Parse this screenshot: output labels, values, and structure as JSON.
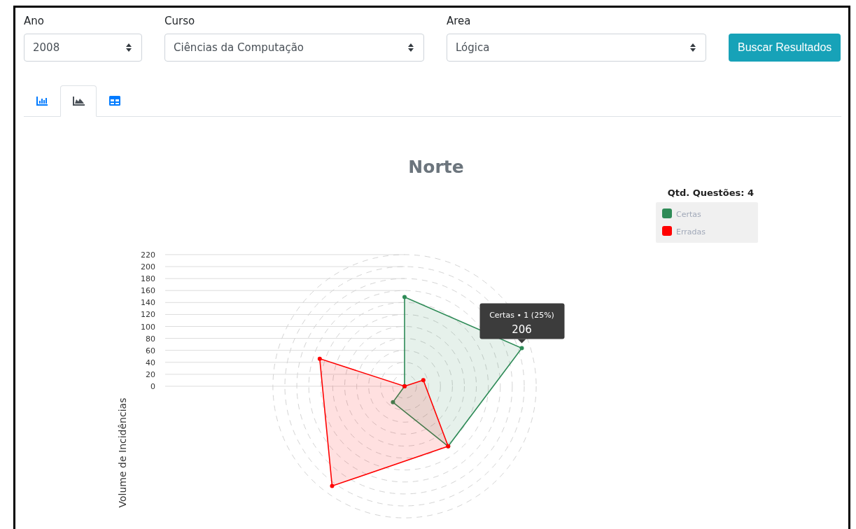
{
  "filters": [
    {
      "label": "Ano",
      "value": "2008",
      "kind": "narrow"
    },
    {
      "label": "Curso",
      "value": "Ciências da Computação",
      "kind": "wide"
    },
    {
      "label": "Area",
      "value": "Lógica",
      "kind": "wide"
    }
  ],
  "search_button": "Buscar Resultados",
  "tabs": [
    {
      "kind": "bar",
      "selected": false
    },
    {
      "kind": "area",
      "selected": true
    },
    {
      "kind": "table",
      "selected": false
    }
  ],
  "chart": {
    "title": "Norte",
    "axis_title": "Volume de Incidências",
    "axis_ticks": [
      "220",
      "200",
      "180",
      "160",
      "140",
      "120",
      "100",
      "80",
      "60",
      "40",
      "20",
      "0"
    ],
    "legend_title": "Qtd. Questões: 4",
    "series": [
      {
        "name": "Certas",
        "color": "#2e8b57"
      },
      {
        "name": "Erradas",
        "color": "#ff0000"
      }
    ],
    "tooltip": {
      "header": "Certas • 1 (25%)",
      "value": "206"
    }
  }
}
